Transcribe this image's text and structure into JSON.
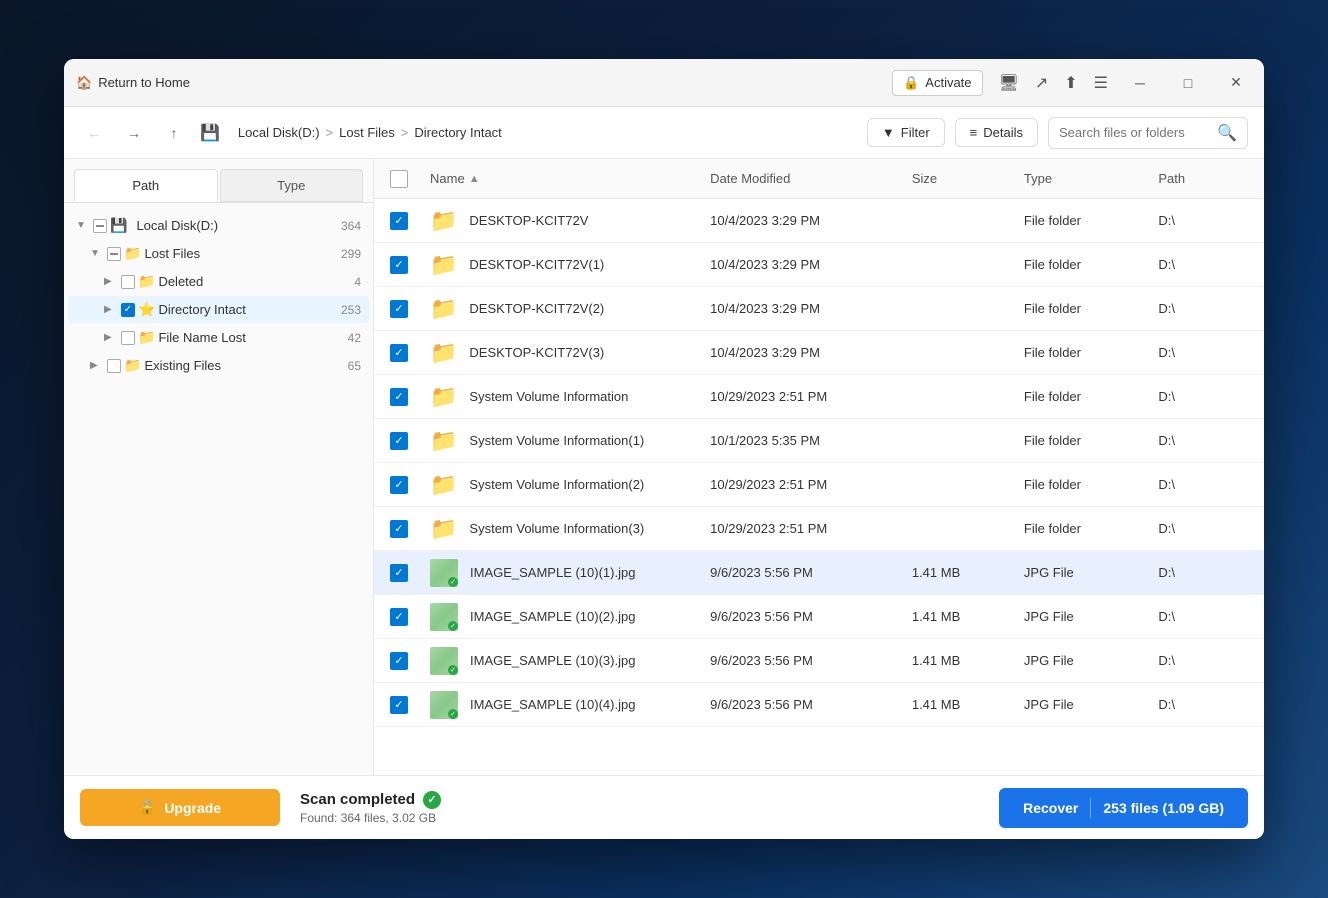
{
  "window": {
    "title": "Return to Home",
    "activate_label": "Activate"
  },
  "toolbar": {
    "breadcrumb": {
      "disk": "Local Disk(D:)",
      "sep1": ">",
      "folder": "Lost Files",
      "sep2": ">",
      "current": "Directory Intact"
    },
    "filter_label": "Filter",
    "details_label": "Details",
    "search_placeholder": "Search files or folders"
  },
  "sidebar": {
    "tab_path": "Path",
    "tab_type": "Type",
    "tree": [
      {
        "label": "Local Disk(D:)",
        "count": 364,
        "level": 0,
        "expanded": true,
        "checked": "partial",
        "icon": "disk"
      },
      {
        "label": "Lost Files",
        "count": 299,
        "level": 1,
        "expanded": true,
        "checked": "partial",
        "icon": "folder-yellow"
      },
      {
        "label": "Deleted",
        "count": 4,
        "level": 2,
        "expanded": false,
        "checked": "unchecked",
        "icon": "folder-gray"
      },
      {
        "label": "Directory Intact",
        "count": 253,
        "level": 2,
        "expanded": false,
        "checked": "checked",
        "icon": "folder-star",
        "active": true
      },
      {
        "label": "File Name Lost",
        "count": 42,
        "level": 2,
        "expanded": false,
        "checked": "unchecked",
        "icon": "folder-orange"
      },
      {
        "label": "Existing Files",
        "count": 65,
        "level": 1,
        "expanded": false,
        "checked": "unchecked",
        "icon": "folder-yellow"
      }
    ]
  },
  "file_list": {
    "columns": {
      "name": "Name",
      "date_modified": "Date Modified",
      "size": "Size",
      "type": "Type",
      "path": "Path"
    },
    "rows": [
      {
        "name": "DESKTOP-KCIT72V",
        "date": "10/4/2023 3:29 PM",
        "size": "",
        "type": "File folder",
        "path": "D:\\",
        "kind": "folder",
        "checked": true,
        "selected": false
      },
      {
        "name": "DESKTOP-KCIT72V(1)",
        "date": "10/4/2023 3:29 PM",
        "size": "",
        "type": "File folder",
        "path": "D:\\",
        "kind": "folder",
        "checked": true,
        "selected": false
      },
      {
        "name": "DESKTOP-KCIT72V(2)",
        "date": "10/4/2023 3:29 PM",
        "size": "",
        "type": "File folder",
        "path": "D:\\",
        "kind": "folder",
        "checked": true,
        "selected": false
      },
      {
        "name": "DESKTOP-KCIT72V(3)",
        "date": "10/4/2023 3:29 PM",
        "size": "",
        "type": "File folder",
        "path": "D:\\",
        "kind": "folder",
        "checked": true,
        "selected": false
      },
      {
        "name": "System Volume Information",
        "date": "10/29/2023 2:51 PM",
        "size": "",
        "type": "File folder",
        "path": "D:\\",
        "kind": "folder",
        "checked": true,
        "selected": false
      },
      {
        "name": "System Volume Information(1)",
        "date": "10/1/2023 5:35 PM",
        "size": "",
        "type": "File folder",
        "path": "D:\\",
        "kind": "folder",
        "checked": true,
        "selected": false
      },
      {
        "name": "System Volume Information(2)",
        "date": "10/29/2023 2:51 PM",
        "size": "",
        "type": "File folder",
        "path": "D:\\",
        "kind": "folder",
        "checked": true,
        "selected": false
      },
      {
        "name": "System Volume Information(3)",
        "date": "10/29/2023 2:51 PM",
        "size": "",
        "type": "File folder",
        "path": "D:\\",
        "kind": "folder",
        "checked": true,
        "selected": false
      },
      {
        "name": "IMAGE_SAMPLE (10)(1).jpg",
        "date": "9/6/2023 5:56 PM",
        "size": "1.41 MB",
        "type": "JPG File",
        "path": "D:\\",
        "kind": "image",
        "checked": true,
        "selected": true
      },
      {
        "name": "IMAGE_SAMPLE (10)(2).jpg",
        "date": "9/6/2023 5:56 PM",
        "size": "1.41 MB",
        "type": "JPG File",
        "path": "D:\\",
        "kind": "image",
        "checked": true,
        "selected": false
      },
      {
        "name": "IMAGE_SAMPLE (10)(3).jpg",
        "date": "9/6/2023 5:56 PM",
        "size": "1.41 MB",
        "type": "JPG File",
        "path": "D:\\",
        "kind": "image",
        "checked": true,
        "selected": false
      },
      {
        "name": "IMAGE_SAMPLE (10)(4).jpg",
        "date": "9/6/2023 5:56 PM",
        "size": "1.41 MB",
        "type": "JPG File",
        "path": "D:\\",
        "kind": "image",
        "checked": true,
        "selected": false
      }
    ]
  },
  "bottom": {
    "upgrade_label": "Upgrade",
    "scan_title": "Scan completed",
    "scan_found": "Found: 364 files, 3.02 GB",
    "recover_label": "Recover",
    "recover_count": "253 files (1.09 GB)"
  },
  "colors": {
    "accent_blue": "#1a73e8",
    "accent_orange": "#f5a623",
    "folder_yellow": "#f5a623",
    "success_green": "#28a745",
    "selected_row": "#e8f0fe"
  }
}
